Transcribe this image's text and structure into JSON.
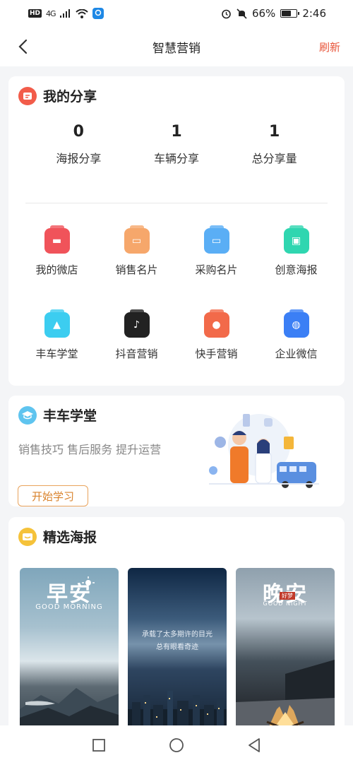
{
  "status_bar": {
    "network": "4G",
    "battery_percent": "66%",
    "battery_level": 0.66,
    "time": "2:46",
    "hd_label": "HD"
  },
  "header": {
    "title": "智慧营销",
    "refresh_label": "刷新"
  },
  "my_share": {
    "title": "我的分享",
    "stats": [
      {
        "value": "0",
        "label": "海报分享"
      },
      {
        "value": "1",
        "label": "车辆分享"
      },
      {
        "value": "1",
        "label": "总分享量"
      }
    ],
    "grid": [
      {
        "label": "我的微店",
        "icon": "shop-icon",
        "color": "#f0535a"
      },
      {
        "label": "销售名片",
        "icon": "card-icon",
        "color": "#f6a76b"
      },
      {
        "label": "采购名片",
        "icon": "card-icon",
        "color": "#5aaef5"
      },
      {
        "label": "创意海报",
        "icon": "poster-icon",
        "color": "#2fd6b0"
      },
      {
        "label": "丰车学堂",
        "icon": "graduation-cap-icon",
        "color": "#3ccdf0"
      },
      {
        "label": "抖音营销",
        "icon": "tiktok-icon",
        "color": "#222222"
      },
      {
        "label": "快手营销",
        "icon": "kuaishou-icon",
        "color": "#f26a4a"
      },
      {
        "label": "企业微信",
        "icon": "wecom-icon",
        "color": "#3b7ff5"
      }
    ]
  },
  "school": {
    "title": "丰车学堂",
    "description": "销售技巧 售后服务 提升运营",
    "button_label": "开始学习"
  },
  "posters": {
    "title": "精选海报",
    "items": [
      {
        "big_text": "早安",
        "small_text": "GOOD MORNING"
      },
      {
        "note_line1": "承载了太多期许的目光",
        "note_line2": "总有眼看奇迹"
      },
      {
        "big_text": "晚安",
        "tag": "好梦",
        "small_text": "GOOD NIGHT"
      }
    ]
  }
}
